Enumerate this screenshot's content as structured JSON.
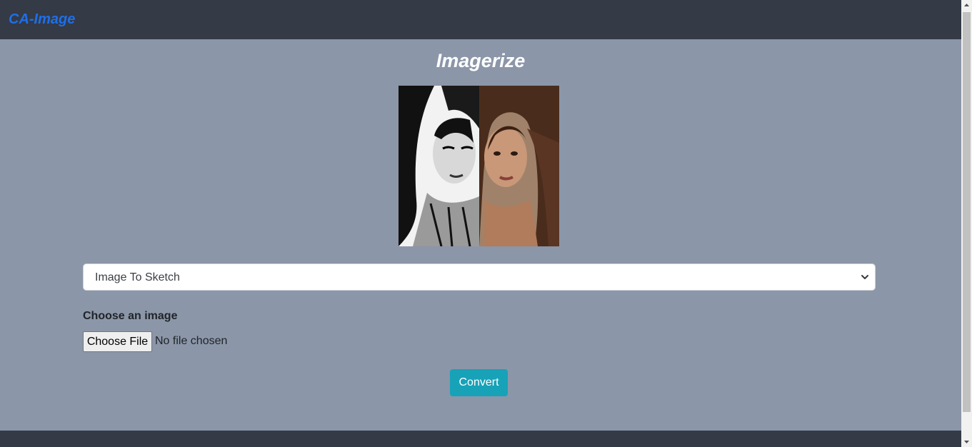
{
  "navbar": {
    "brand": "CA-Image"
  },
  "main": {
    "title": "Imagerize",
    "preview_image": "portrait-sketch-comparison",
    "conversion_select": {
      "selected": "Image To Sketch"
    },
    "file_input": {
      "label": "Choose an image",
      "button_label": "Choose File",
      "status": "No file chosen"
    },
    "convert_label": "Convert"
  },
  "colors": {
    "navbar_bg": "#343a46",
    "page_bg": "#8b96a8",
    "brand": "#1e6fe8",
    "convert_button": "#17a2b8"
  }
}
